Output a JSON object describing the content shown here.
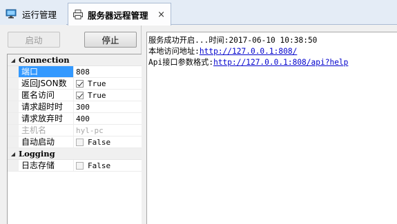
{
  "tabs": [
    {
      "label": "运行管理",
      "icon": "monitor-icon",
      "active": false
    },
    {
      "label": "服务器远程管理",
      "icon": "printer-icon",
      "active": true,
      "close_glyph": "×"
    }
  ],
  "buttons": {
    "start_label": "启动",
    "stop_label": "停止"
  },
  "property_grid": {
    "categories": [
      {
        "name": "Connection",
        "rows": [
          {
            "name": "端口",
            "value": "808",
            "type": "text",
            "selected": true
          },
          {
            "name": "返回JSON数",
            "value": "True",
            "type": "checkbox",
            "checked": true
          },
          {
            "name": "匿名访问",
            "value": "True",
            "type": "checkbox",
            "checked": true
          },
          {
            "name": "请求超时时",
            "value": "300",
            "type": "text"
          },
          {
            "name": "请求放弃时",
            "value": "400",
            "type": "text"
          },
          {
            "name": "主机名",
            "value": "hyl-pc",
            "type": "text",
            "disabled": true
          },
          {
            "name": "自动启动",
            "value": "False",
            "type": "checkbox",
            "checked": false
          }
        ]
      },
      {
        "name": "Logging",
        "rows": [
          {
            "name": "日志存储",
            "value": "False",
            "type": "checkbox",
            "checked": false
          }
        ]
      }
    ]
  },
  "log": {
    "line1": "服务成功开启...时间:2017-06-10 10:38:50",
    "line2_prefix": "本地访问地址:",
    "line2_link": "http://127.0.0.1:808/",
    "line3_prefix": "Api接口参数格式:",
    "line3_link": "http://127.0.0.1:808/api?help"
  },
  "colors": {
    "selection": "#3399ff",
    "link": "#0000cc",
    "tab_bg": "#e4ecf6"
  }
}
